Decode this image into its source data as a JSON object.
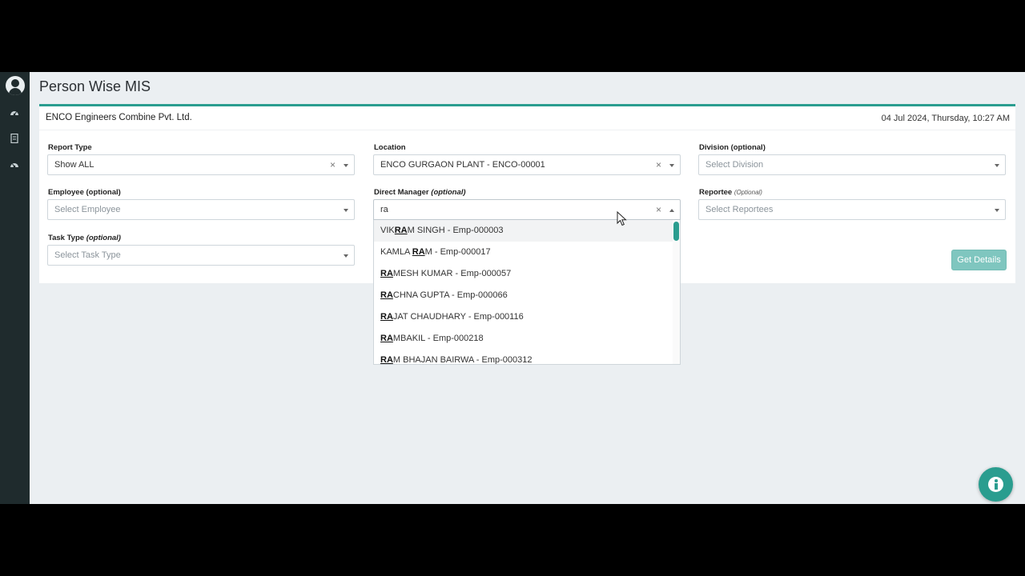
{
  "page": {
    "title": "Person Wise MIS"
  },
  "header": {
    "company": "ENCO Engineers Combine Pvt. Ltd.",
    "datetime": "04 Jul 2024, Thursday, 10:27 AM"
  },
  "fields": {
    "report_type": {
      "label": "Report Type",
      "value": "Show ALL"
    },
    "location": {
      "label": "Location",
      "value": "ENCO GURGAON PLANT - ENCO-00001"
    },
    "division": {
      "label": "Division (optional)",
      "placeholder": "Select Division"
    },
    "employee": {
      "label": "Employee (optional)",
      "placeholder": "Select Employee"
    },
    "direct_manager": {
      "label": "Direct Manager",
      "label_opt": "(optional)",
      "value": "ra"
    },
    "reportee": {
      "label": "Reportee",
      "label_opt": "(Optional)",
      "placeholder": "Select Reportees"
    },
    "task_type": {
      "label": "Task Type",
      "label_opt": "(optional)",
      "placeholder": "Select Task Type"
    }
  },
  "buttons": {
    "get_details": "Get Details",
    "clear": "×"
  },
  "dropdown": {
    "options": [
      {
        "pre": "VIK",
        "match": "RA",
        "post": "M SINGH - Emp-000003"
      },
      {
        "pre": "KAMLA ",
        "match": "RA",
        "post": "M - Emp-000017"
      },
      {
        "pre": "",
        "match": "RA",
        "post": "MESH KUMAR - Emp-000057"
      },
      {
        "pre": "",
        "match": "RA",
        "post": "CHNA GUPTA - Emp-000066"
      },
      {
        "pre": "",
        "match": "RA",
        "post": "JAT CHAUDHARY - Emp-000116"
      },
      {
        "pre": "",
        "match": "RA",
        "post": "MBAKIL - Emp-000218"
      },
      {
        "pre": "",
        "match": "RA",
        "post": "M BHAJAN BAIRWA - Emp-000312"
      }
    ]
  },
  "colors": {
    "accent": "#2a9d8f",
    "sidebar": "#1f2b2d",
    "button_disabled": "#7fc6bf"
  },
  "icons": {
    "sidebar": [
      "user-avatar-icon",
      "dashboard-icon",
      "report-icon",
      "settings-dashboard-icon"
    ],
    "fab": "info-icon"
  }
}
